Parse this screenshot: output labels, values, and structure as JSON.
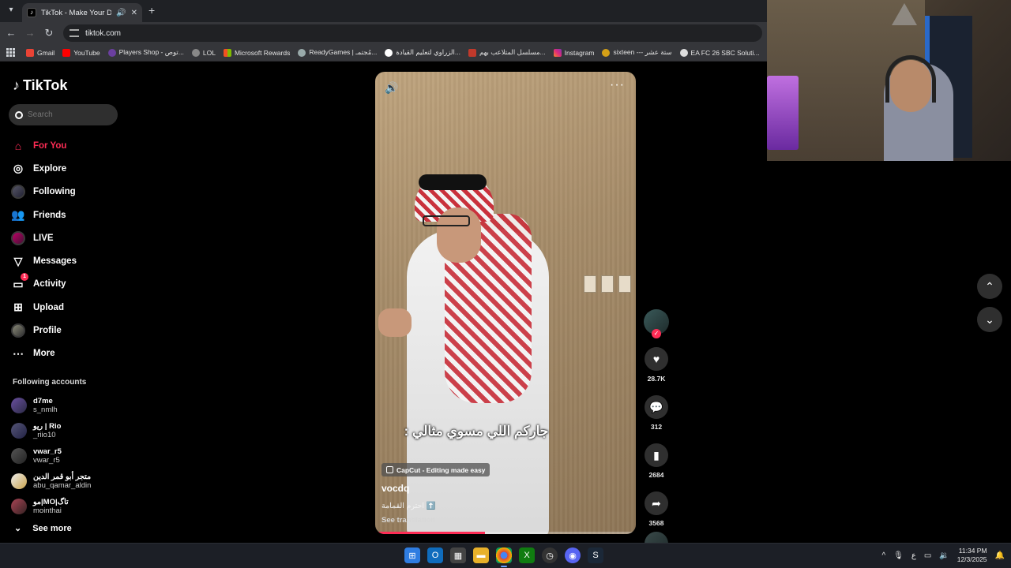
{
  "browser": {
    "tab_title": "TikTok - Make Your Day",
    "url": "tiktok.com",
    "bookmarks": [
      "Gmail",
      "YouTube",
      "Players Shop - توص...",
      "LOL",
      "Microsoft Rewards",
      "ReadyGames | مُجتمـ...",
      "الزراوي لتعليم القيادة...",
      "مسلسل المتلاعب بهم...",
      "Instagram",
      "sixteen --- ستة عشر",
      "EA FC 26 SBC Soluti..."
    ]
  },
  "sidebar": {
    "logo": "TikTok",
    "search_placeholder": "Search",
    "nav": [
      {
        "label": "For You",
        "icon": "home-icon"
      },
      {
        "label": "Explore",
        "icon": "compass-icon"
      },
      {
        "label": "Following",
        "icon": "following-avatar-icon"
      },
      {
        "label": "Friends",
        "icon": "friends-icon"
      },
      {
        "label": "LIVE",
        "icon": "live-avatar-icon"
      },
      {
        "label": "Messages",
        "icon": "send-icon"
      },
      {
        "label": "Activity",
        "icon": "activity-icon",
        "badge": "1"
      },
      {
        "label": "Upload",
        "icon": "plus-square-icon"
      },
      {
        "label": "Profile",
        "icon": "profile-avatar-icon"
      },
      {
        "label": "More",
        "icon": "more-icon"
      }
    ],
    "following_title": "Following accounts",
    "accounts": [
      {
        "name": "d7me",
        "handle": "s_nmlh"
      },
      {
        "name": "ريو | Rio",
        "handle": "_riio10"
      },
      {
        "name": "vwar_r5",
        "handle": "vwar_r5"
      },
      {
        "name": "متجر أبو قمر الدين",
        "handle": "abu_qamar_aldin"
      },
      {
        "name": "مو|MO|تاگ",
        "handle": "mointhai"
      }
    ],
    "see_more": "See more"
  },
  "video": {
    "caption": "جاركم اللي مسوي مثالي :",
    "ad_chip": "CapCut - Editing made easy",
    "author": "vocdq",
    "description": "احترم القمامة ⬆️",
    "see_translation": "See translation",
    "progress": 0.42
  },
  "actions": {
    "likes": "28.7K",
    "comments": "312",
    "saves": "2684",
    "shares": "3568"
  },
  "taskbar": {
    "time": "11:34 PM",
    "date": "12/3/2025",
    "lang": "ع"
  }
}
